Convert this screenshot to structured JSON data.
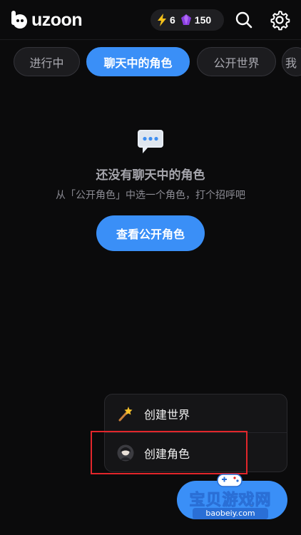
{
  "app": {
    "logo_text": "uzoon"
  },
  "header": {
    "energy_count": "6",
    "gems_count": "150",
    "icons": {
      "energy": "lightning-bolt-icon",
      "gems": "purple-gem-icon",
      "search": "search-icon",
      "settings": "gear-icon"
    }
  },
  "tabs": [
    {
      "label": "进行中",
      "active": false
    },
    {
      "label": "聊天中的角色",
      "active": true
    },
    {
      "label": "公开世界",
      "active": false
    },
    {
      "label": "我",
      "active": false
    }
  ],
  "empty_state": {
    "icon": "speech-bubble-icon",
    "title": "还没有聊天中的角色",
    "subtitle": "从「公开角色」中选一个角色，打个招呼吧",
    "button_label": "查看公开角色"
  },
  "create_menu": {
    "items": [
      {
        "label": "创建世界",
        "icon": "magic-wand-icon"
      },
      {
        "label": "创建角色",
        "icon": "character-avatar-icon",
        "highlighted": true
      }
    ]
  },
  "watermark": {
    "text": "宝贝游戏网",
    "url": "baobeiy.com"
  },
  "colors": {
    "accent": "#3a8ff7",
    "background": "#0b0b0c",
    "highlight": "#e2262b"
  }
}
